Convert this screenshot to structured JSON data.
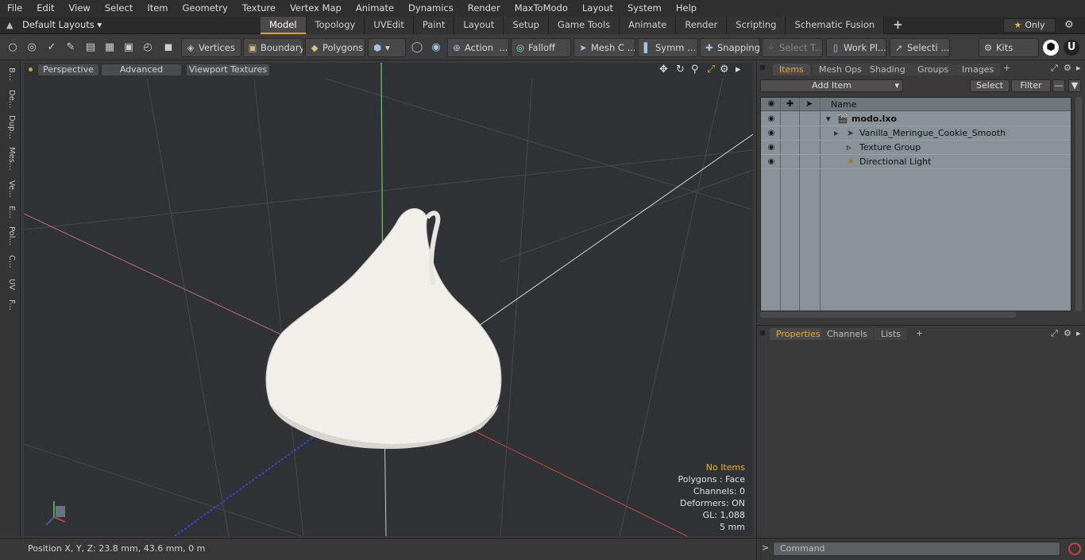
{
  "menu": [
    "File",
    "Edit",
    "View",
    "Select",
    "Item",
    "Geometry",
    "Texture",
    "Vertex Map",
    "Animate",
    "Dynamics",
    "Render",
    "MaxToModo",
    "Layout",
    "System",
    "Help"
  ],
  "layout_dropdown": "Default Layouts ▾",
  "tabs": [
    "Model",
    "Topology",
    "UVEdit",
    "Paint",
    "Layout",
    "Setup",
    "Game Tools",
    "Animate",
    "Render",
    "Scripting",
    "Schematic Fusion"
  ],
  "tab_add": "+",
  "only_label": "Only",
  "toolbar": {
    "vertices": "Vertices",
    "boundary": "Boundary",
    "polygons": "Polygons",
    "action": "Action",
    "falloff": "Falloff",
    "mesh_c": "Mesh C ...",
    "symm": "Symm ...",
    "snapping": "Snapping",
    "select_t": "Select T...",
    "work_pl": "Work Pl...",
    "selecti": "Selecti ...",
    "kits": "Kits"
  },
  "left_tabs": [
    "B...",
    "De...",
    "Dup...",
    "Mes...",
    "Ve...",
    "E...",
    "Pol...",
    "C...",
    "UV",
    "F..."
  ],
  "viewport": {
    "perspective": "Perspective",
    "advanced": "Advanced",
    "viewport_textures": "Viewport Textures",
    "info": {
      "items": "No Items",
      "polygons": "Polygons : Face",
      "channels": "Channels: 0",
      "deformers": "Deformers: ON",
      "gl": "GL: 1,088",
      "scale": "5 mm"
    }
  },
  "status": "Position X, Y, Z:   23.8 mm, 43.6 mm, 0 m",
  "items_panel": {
    "tabs": [
      "Items",
      "Mesh Ops",
      "Shading",
      "Groups",
      "Images"
    ],
    "add_item": "Add Item",
    "select": "Select",
    "filter": "Filter",
    "name_header": "Name",
    "tree": [
      {
        "label": "modo.lxo",
        "bold": true
      },
      {
        "label": "Vanilla_Meringue_Cookie_Smooth"
      },
      {
        "label": "Texture Group"
      },
      {
        "label": "Directional Light"
      }
    ]
  },
  "props_panel": {
    "tabs": [
      "Properties",
      "Channels",
      "Lists"
    ]
  },
  "command_placeholder": "Command",
  "colors": {
    "accent": "#e0a030",
    "tree_bg": "#8a9299",
    "viewport_bg": "#2f3336"
  }
}
